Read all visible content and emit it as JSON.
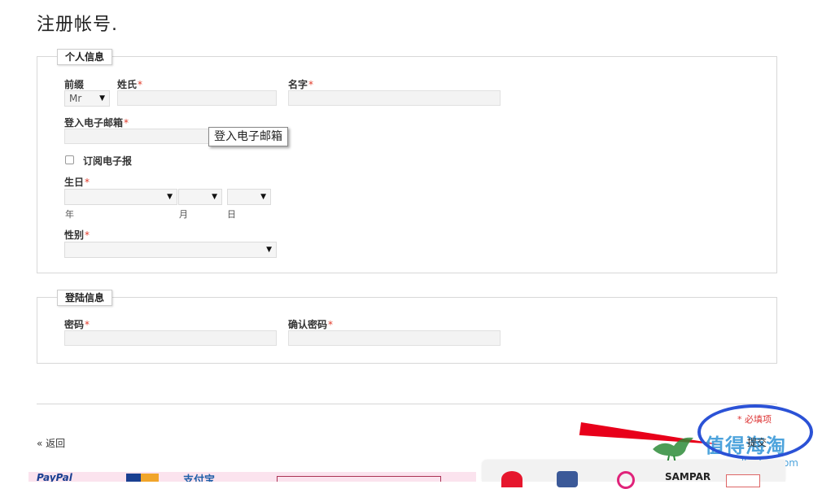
{
  "page": {
    "title": "注册帐号."
  },
  "personal": {
    "legend": "个人信息",
    "prefix_label": "前缀",
    "prefix_value": "Mr",
    "lastname_label": "姓氏",
    "firstname_label": "名字",
    "email_label": "登入电子邮箱",
    "email_tooltip": "登入电子邮箱",
    "newsletter_label": "订阅电子报",
    "birthday_label": "生日",
    "year_label": "年",
    "month_label": "月",
    "day_label": "日",
    "gender_label": "性别",
    "required_mark": "*"
  },
  "login": {
    "legend": "登陆信息",
    "password_label": "密码",
    "confirm_label": "确认密码"
  },
  "footer": {
    "required_note": "* 必填项",
    "back_link": "« 返回",
    "submit_text": "提交"
  },
  "watermark": {
    "title": "值得海淘",
    "url": "www.zdhaitao.com"
  },
  "strip": {
    "paypal": "PayPal",
    "alipay": "支付宝"
  },
  "social": {
    "sampar": "SAMPAR"
  },
  "colors": {
    "required": "#e23b2a",
    "annotation_circle": "#2b52d6",
    "annotation_arrow": "#e8001a"
  }
}
